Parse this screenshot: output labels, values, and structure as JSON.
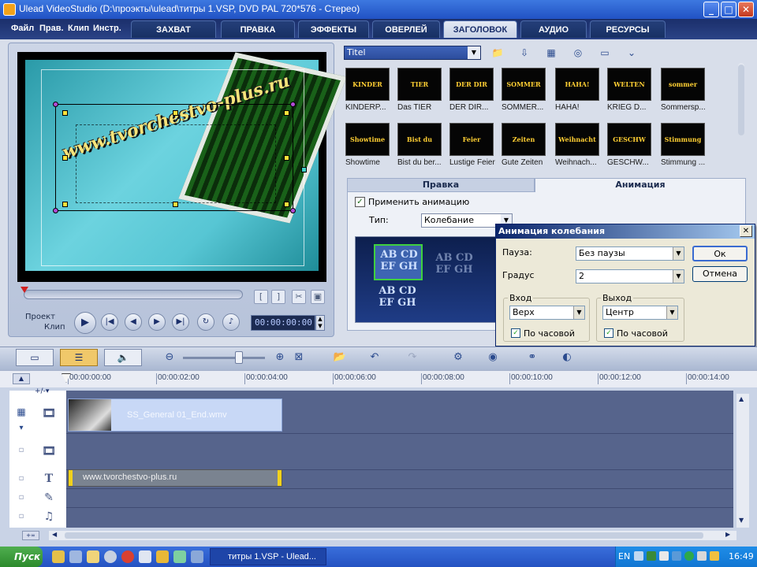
{
  "window": {
    "title": "Ulead VideoStudio (D:\\проэкты\\ulead\\титры 1.VSP, DVD PAL 720*576 - Стерео)",
    "minimize": "_",
    "maximize": "□",
    "close": "✕"
  },
  "menu": [
    "Файл",
    "Прав.",
    "Клип",
    "Инстр."
  ],
  "tabs": [
    "ЗАХВАТ",
    "ПРАВКА",
    "ЭФФЕКТЫ",
    "ОВЕРЛЕЙ",
    "ЗАГОЛОВОК",
    "АУДИО",
    "РЕСУРСЫ"
  ],
  "active_tab": "ЗАГОЛОВОК",
  "preview": {
    "overlay_text": "www.tvorchestvo-plus.ru",
    "label_project": "Проект",
    "label_clip": "Клип",
    "timecode": "00:00:00:00"
  },
  "library": {
    "category": "Titel",
    "items": [
      {
        "label": "KINDERP...",
        "art": "KINDER"
      },
      {
        "label": "Das TIER",
        "art": "TIER"
      },
      {
        "label": "DER DIR...",
        "art": "DER DIR"
      },
      {
        "label": "SOMMER...",
        "art": "SOMMER"
      },
      {
        "label": "HAHA!",
        "art": "HAHA!"
      },
      {
        "label": "KRIEG D...",
        "art": "WELTEN"
      },
      {
        "label": "Sommersp...",
        "art": "sommer"
      },
      {
        "label": "Showtime",
        "art": "Showtime"
      },
      {
        "label": "Bist du ber...",
        "art": "Bist du"
      },
      {
        "label": "Lustige Feier",
        "art": "Feier"
      },
      {
        "label": "Gute Zeiten",
        "art": "Zeiten"
      },
      {
        "label": "Weihnach...",
        "art": "Weihnacht"
      },
      {
        "label": "GESCHW...",
        "art": "GESCHW"
      },
      {
        "label": "Stimmung ...",
        "art": "Stimmung"
      }
    ]
  },
  "options": {
    "tab_edit": "Правка",
    "tab_animation": "Анимация",
    "apply_animation": "Применить анимацию",
    "apply_checked": "✓",
    "type_label": "Тип:",
    "type_value": "Колебание",
    "preview_text_1": "AB CD EF GH",
    "preview_text_2": "AB CD EF GH",
    "preview_text_3": "AB CD EF GH"
  },
  "dialog": {
    "title": "Анимация колебания",
    "close": "✕",
    "pause_label": "Пауза:",
    "pause_value": "Без паузы",
    "degree_label": "Градус",
    "degree_value": "2",
    "ok": "Ок",
    "cancel": "Отмена",
    "in_group": "Вход",
    "in_value": "Верх",
    "in_clockwise": "По часовой",
    "out_group": "Выход",
    "out_value": "Центр",
    "out_clockwise": "По часовой",
    "check": "✓"
  },
  "timeline": {
    "ticks": [
      "00:00:00:00",
      "00:00:02:00",
      "00:00:04:00",
      "00:00:06:00",
      "00:00:08:00",
      "00:00:10:00",
      "00:00:12:00",
      "00:00:14:00"
    ],
    "video_clip": "SS_General 01_End.wmv",
    "title_clip": "www.tvorchestvo-plus.ru",
    "track_icons": [
      "🎞",
      "🎞",
      "T",
      "✎",
      "♫"
    ]
  },
  "taskbar": {
    "start": "Пуск",
    "task": "титры 1.VSP - Ulead...",
    "lang": "EN",
    "clock": "16:49"
  },
  "colors": {
    "title_bar": "#2152c4",
    "tab_strip": "#1b2f6b",
    "track_bg": "#56648c",
    "title_clip_handle": "#f2d21c"
  }
}
